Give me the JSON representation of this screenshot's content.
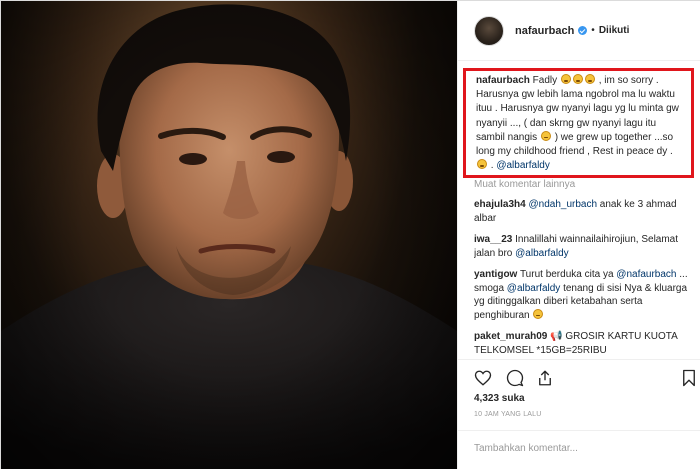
{
  "header": {
    "username": "nafaurbach",
    "separator": "•",
    "follow_status": "Diikuti"
  },
  "caption": {
    "username": "nafaurbach",
    "text_1": " Fadly ",
    "text_2": " , im so sorry . Harusnya gw lebih lama ngobrol ma lu waktu ituu . Harusnya gw nyanyi lagu yg lu minta gw nyanyii ..., ( dan skrng gw nyanyi lagu itu sambil nangis ",
    "text_3": " ) we grew up together ...so long my childhood friend , Rest in peace dy . ",
    "text_4": " . ",
    "mention": "@albarfaldy"
  },
  "more_comments": "Muat komentar lainnya",
  "comments": [
    {
      "user": "ehajula3h4",
      "before": " ",
      "mention": "@ndah_urbach",
      "after": " anak ke 3 ahmad albar"
    },
    {
      "user": "iwa__23",
      "before": " Innalillahi wainnailaihirojiun, Selamat jalan bro ",
      "mention": "@albarfaldy",
      "after": ""
    },
    {
      "user": "yantigow",
      "before": " Turut berduka cita ya ",
      "mention": "@nafaurbach",
      "after": " ... smoga ",
      "mention2": "@albarfaldy",
      "after2": " tenang di sisi Nya & kluarga yg ditinggalkan diberi ketabahan serta penghiburan "
    },
    {
      "user": "paket_murah09",
      "before": " 📢 GROSIR KARTU KUOTA TELKOMSEL *15GB=25RIBU",
      "mention": "",
      "after": ""
    }
  ],
  "likes": "4,323 suka",
  "time": "10 JAM YANG LALU",
  "add_comment_placeholder": "Tambahkan komentar..."
}
